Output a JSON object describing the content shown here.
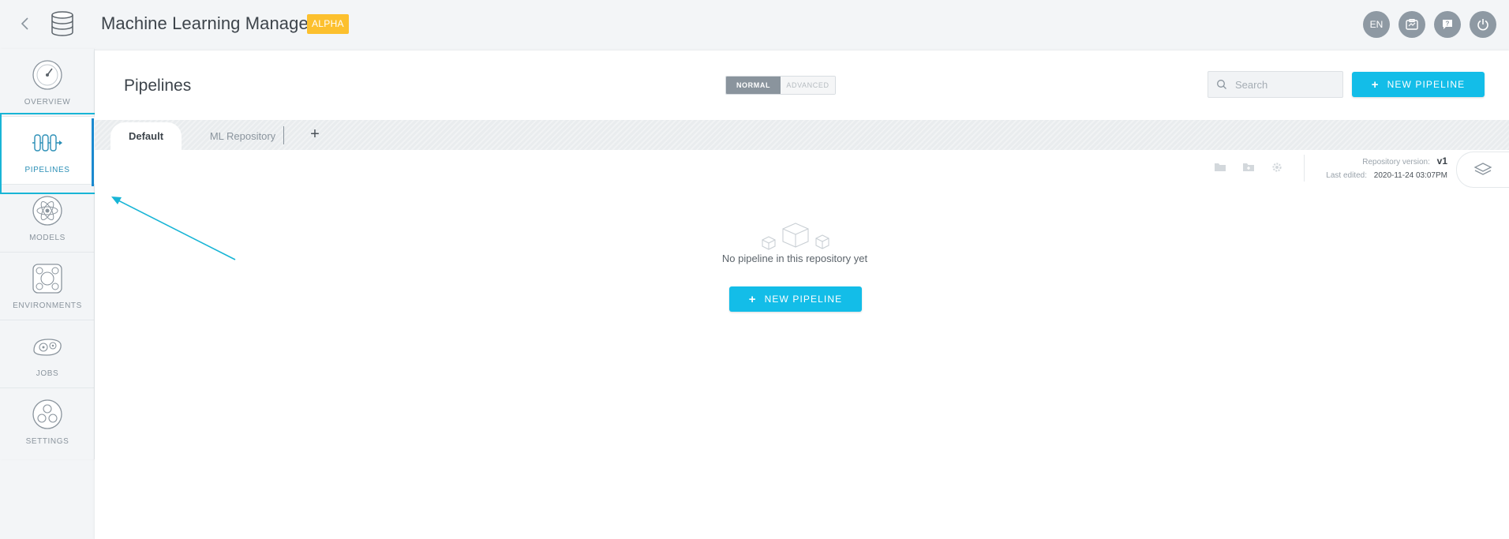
{
  "header": {
    "title": "Machine Learning Manager",
    "badge": "ALPHA",
    "language": "EN",
    "icons": [
      "back-icon",
      "database-icon",
      "dashboard-icon",
      "chat-icon",
      "power-icon"
    ]
  },
  "sidebar": {
    "items": [
      {
        "label": "OVERVIEW",
        "icon": "gauge-icon"
      },
      {
        "label": "PIPELINES",
        "icon": "pipeline-icon"
      },
      {
        "label": "MODELS",
        "icon": "atom-icon"
      },
      {
        "label": "ENVIRONMENTS",
        "icon": "environment-icon"
      },
      {
        "label": "JOBS",
        "icon": "gears-icon"
      },
      {
        "label": "SETTINGS",
        "icon": "settings-icon"
      }
    ],
    "active": "PIPELINES"
  },
  "main": {
    "title": "Pipelines",
    "mode": {
      "normal": "NORMAL",
      "advanced": "ADVANCED",
      "selected": "NORMAL"
    },
    "search": {
      "placeholder": "Search"
    },
    "new_pipeline_label": "NEW PIPELINE",
    "tabs": [
      {
        "label": "Default",
        "active": true
      },
      {
        "label": "ML Repository",
        "active": false
      }
    ],
    "add_tab_label": "+",
    "repo": {
      "version_label": "Repository version:",
      "version": "v1",
      "edited_label": "Last edited:",
      "edited": "2020-11-24 03:07PM"
    },
    "empty": {
      "message": "No pipeline in this repository yet",
      "button_label": "NEW PIPELINE"
    }
  },
  "colors": {
    "accent": "#13bde8",
    "badge": "#fcc02e",
    "highlight": "#18b5d6",
    "active_bar": "#1b8bd1",
    "round_button": "#8e99a3"
  }
}
